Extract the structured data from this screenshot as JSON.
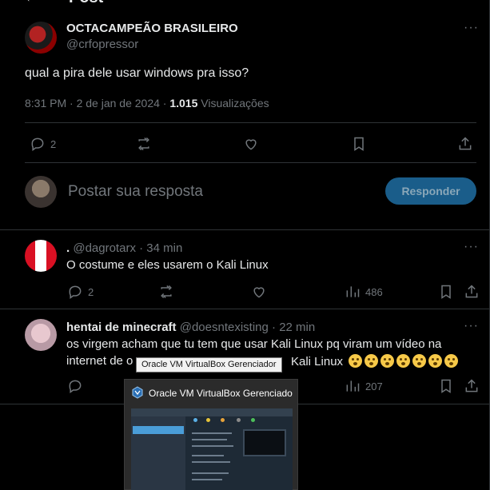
{
  "header": {
    "back_label": "←",
    "title": "Post"
  },
  "post": {
    "display_name": "OCTACAMPEÃO BRASILEIRO",
    "handle": "@crfopressor",
    "text": "qual a pira dele usar windows pra isso?",
    "timestamp": "8:31 PM · 2 de jan de 2024 ·",
    "views_count": "1.015",
    "views_label": "Visualizações",
    "replies": "2"
  },
  "composer": {
    "placeholder": "Postar sua resposta",
    "button_label": "Responder"
  },
  "replies": [
    {
      "display_name": ".",
      "handle": "@dagrotarx",
      "sep": "·",
      "time": "34 min",
      "text": "O costume e eles usarem o Kali Linux",
      "replies": "2",
      "views": "486"
    },
    {
      "display_name": "hentai de minecraft",
      "handle": "@doesntexisting",
      "sep": "·",
      "time": "22 min",
      "line1": "os virgem acham que tu tem que usar Kali Linux pq viram um vídeo na",
      "line2_start": "internet de o",
      "line2_end": "Kali Linux",
      "views": "207"
    }
  ],
  "taskbar_tooltip": "Oracle VM VirtualBox Gerenciador",
  "preview": {
    "title": "Oracle VM VirtualBox Gerenciador"
  },
  "icons": {
    "more": "more-icon",
    "reply": "reply-icon",
    "repost": "repost-icon",
    "like": "heart-icon",
    "bookmark": "bookmark-icon",
    "share": "share-icon",
    "views": "views-chart-icon",
    "emoji": "astonished-face-emoji"
  },
  "colors": {
    "background": "#000000",
    "accent": "#1d9bf0",
    "muted": "#71767b",
    "text": "#e7e9ea",
    "border": "#2f3336"
  }
}
